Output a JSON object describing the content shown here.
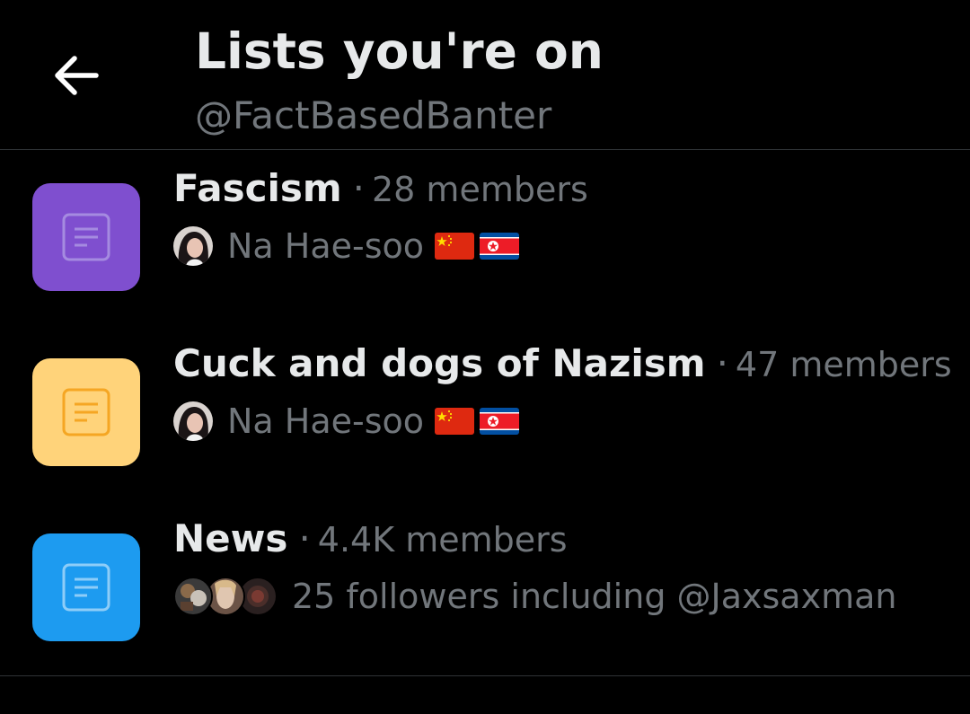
{
  "header": {
    "title": "Lists you're on",
    "handle": "@FactBasedBanter"
  },
  "lists": [
    {
      "name": "Fascism",
      "separator": "·",
      "members": "28 members",
      "owner": "Na Hae-soo",
      "icon_color": "#7f4fcf"
    },
    {
      "name": "Cuck and dogs of Nazism",
      "separator": "·",
      "members": "47 members",
      "owner": "Na Hae-soo",
      "icon_color": "#ffd37a"
    },
    {
      "name": "News",
      "separator": "·",
      "members": "4.4K members",
      "followers": "25 followers including @Jaxsaxman",
      "icon_color": "#1d9bf0"
    }
  ],
  "icons": {
    "back": "arrow-left-icon",
    "list": "list-document-icon",
    "flags": [
      "china-flag-icon",
      "north-korea-flag-icon"
    ]
  }
}
